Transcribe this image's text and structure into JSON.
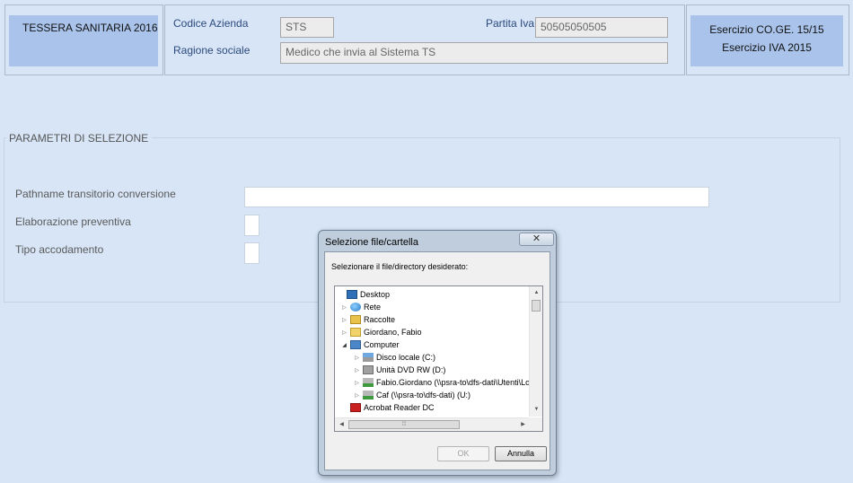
{
  "header": {
    "app_box": "TESSERA SANITARIA 2016",
    "codice_azienda_label": "Codice  Azienda",
    "codice_azienda_value": "STS",
    "partita_iva_label": "Partita Iva",
    "partita_iva_value": "50505050505",
    "ragione_sociale_label": "Ragione sociale",
    "ragione_sociale_value": "Medico che invia al Sistema TS",
    "esercizio_coge": "Esercizio CO.GE. 15/15",
    "esercizio_iva": "Esercizio IVA 2015"
  },
  "selection": {
    "legend": "PARAMETRI DI SELEZIONE",
    "pathname_label": "Pathname transitorio conversione",
    "pathname_value": "",
    "elaborazione_label": "Elaborazione preventiva",
    "tipo_label": "Tipo accodamento"
  },
  "dialog": {
    "title": "Selezione file/cartella",
    "close_label": "✕",
    "prompt": "Selezionare il file/directory desiderato:",
    "tree": [
      {
        "label": "Desktop",
        "icon": "desktop-icon",
        "expander": ""
      },
      {
        "label": "Rete",
        "icon": "network-icon",
        "expander": "▷"
      },
      {
        "label": "Raccolte",
        "icon": "libraries-icon",
        "expander": "▷"
      },
      {
        "label": "Giordano, Fabio",
        "icon": "user-folder-icon",
        "expander": "▷"
      },
      {
        "label": "Computer",
        "icon": "computer-icon",
        "expander": "◢"
      },
      {
        "label": "Disco locale (C:)",
        "icon": "drive-icon",
        "expander": "▷"
      },
      {
        "label": "Unità DVD RW (D:)",
        "icon": "dvd-drive-icon",
        "expander": "▷"
      },
      {
        "label": "Fabio.Giordano (\\\\psra-to\\dfs-dati\\Utenti\\Lo",
        "icon": "network-drive-icon",
        "expander": "▷"
      },
      {
        "label": "Caf (\\\\psra-to\\dfs-dati) (U:)",
        "icon": "network-drive-icon",
        "expander": "▷"
      },
      {
        "label": "Acrobat Reader DC",
        "icon": "acrobat-icon",
        "expander": ""
      }
    ],
    "ok_label": "OK",
    "cancel_label": "Annulla"
  }
}
